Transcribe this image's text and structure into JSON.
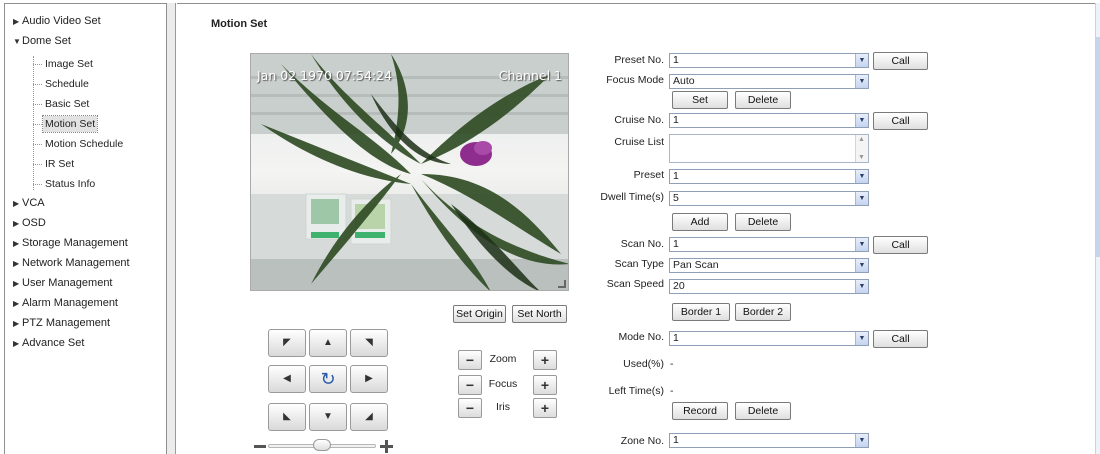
{
  "sidebar": {
    "items": [
      {
        "label": "Audio Video Set",
        "arrow": "▶"
      },
      {
        "label": "Dome Set",
        "arrow": "▼"
      },
      {
        "label": "VCA",
        "arrow": "▶"
      },
      {
        "label": "OSD",
        "arrow": "▶"
      },
      {
        "label": "Storage Management",
        "arrow": "▶"
      },
      {
        "label": "Network Management",
        "arrow": "▶"
      },
      {
        "label": "User Management",
        "arrow": "▶"
      },
      {
        "label": "Alarm Management",
        "arrow": "▶"
      },
      {
        "label": "PTZ Management",
        "arrow": "▶"
      },
      {
        "label": "Advance Set",
        "arrow": "▶"
      }
    ],
    "dome_children": [
      "Image Set",
      "Schedule",
      "Basic Set",
      "Motion Set",
      "Motion Schedule",
      "IR Set",
      "Status Info"
    ],
    "active_child": "Motion Set"
  },
  "page": {
    "title": "Motion Set"
  },
  "video": {
    "timestamp": "Jan 02 1970 07:54:24",
    "channel": "Channel 1"
  },
  "video_controls": {
    "set_origin": "Set Origin",
    "set_north": "Set North"
  },
  "lens": {
    "zoom": "Zoom",
    "focus": "Focus",
    "iris": "Iris",
    "minus": "−",
    "plus": "+"
  },
  "ptz_icons": {
    "up_left": "◤",
    "up": "▲",
    "up_right": "◥",
    "left": "◀",
    "center": "↻",
    "right": "▶",
    "down_left": "◣",
    "down": "▼",
    "down_right": "◢"
  },
  "speed_slider": {
    "minus": "−",
    "plus": "+",
    "level": 0.5
  },
  "form": {
    "preset_no": {
      "label": "Preset No.",
      "value": "1"
    },
    "focus_mode": {
      "label": "Focus Mode",
      "value": "Auto"
    },
    "cruise_no": {
      "label": "Cruise No.",
      "value": "1"
    },
    "cruise_list": {
      "label": "Cruise List"
    },
    "preset": {
      "label": "Preset",
      "value": "1"
    },
    "dwell_time": {
      "label": "Dwell Time(s)",
      "value": "5"
    },
    "scan_no": {
      "label": "Scan No.",
      "value": "1"
    },
    "scan_type": {
      "label": "Scan Type",
      "value": "Pan Scan"
    },
    "scan_speed": {
      "label": "Scan Speed",
      "value": "20"
    },
    "mode_no": {
      "label": "Mode No.",
      "value": "1"
    },
    "used": {
      "label": "Used(%)",
      "value": "-"
    },
    "left_time": {
      "label": "Left Time(s)",
      "value": "-"
    },
    "zone_no": {
      "label": "Zone No.",
      "value": "1"
    }
  },
  "buttons": {
    "call": "Call",
    "set": "Set",
    "delete": "Delete",
    "add": "Add",
    "border1": "Border 1",
    "border2": "Border 2",
    "record": "Record"
  },
  "colors": {
    "accent": "#c6d4ec",
    "selection": "#e2e2e2"
  }
}
